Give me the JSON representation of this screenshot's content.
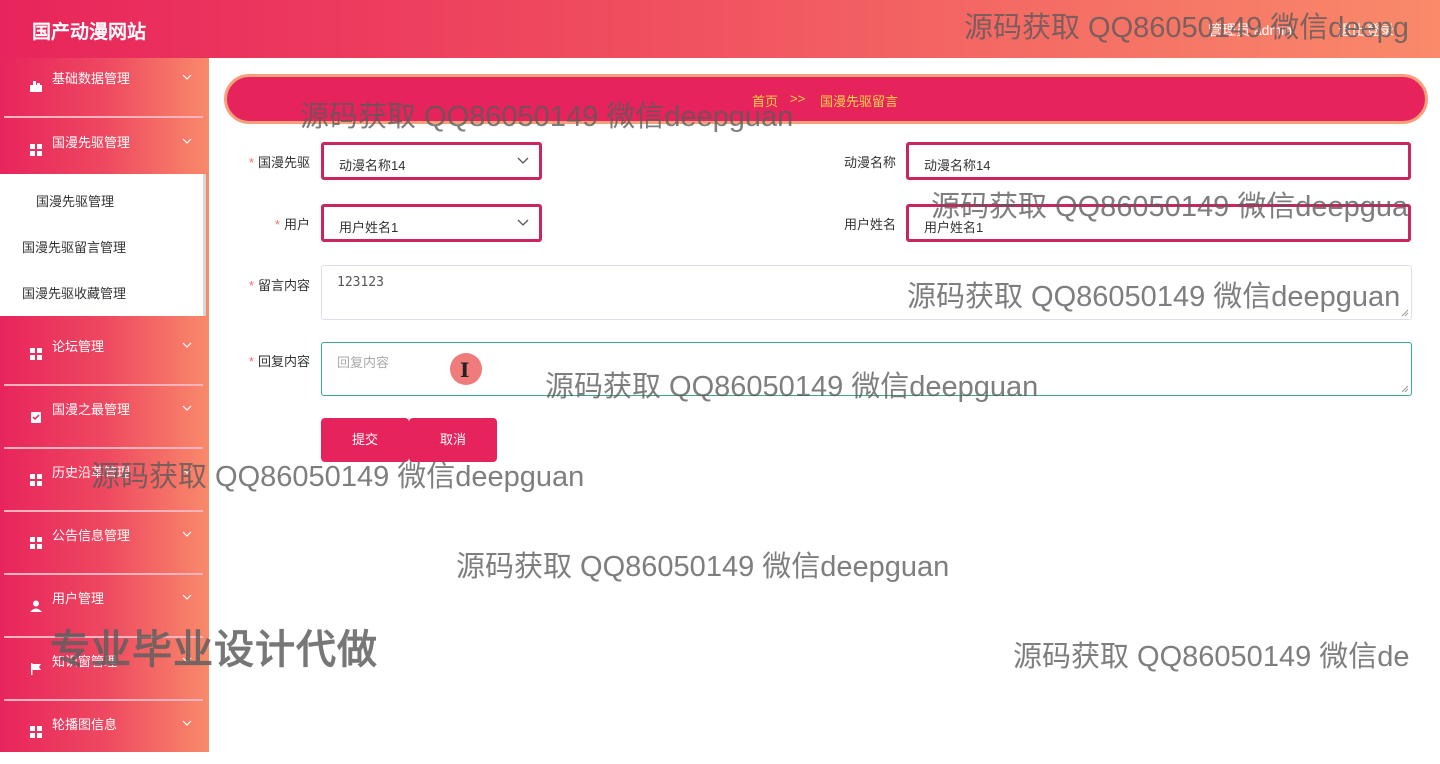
{
  "header": {
    "app_title": "国产动漫网站",
    "admin_text": "管理员 admin",
    "logout_text": "退出登录"
  },
  "sidebar": {
    "items": [
      {
        "label": "基础数据管理",
        "icon": "chart-icon"
      },
      {
        "label": "国漫先驱管理",
        "icon": "grid-icon"
      },
      {
        "label": "论坛管理",
        "icon": "grid-icon"
      },
      {
        "label": "国漫之最管理",
        "icon": "clipboard-icon"
      },
      {
        "label": "历史沿革管理",
        "icon": "grid-icon"
      },
      {
        "label": "公告信息管理",
        "icon": "grid-icon"
      },
      {
        "label": "用户管理",
        "icon": "user-icon"
      },
      {
        "label": "知识窗管理",
        "icon": "flag-icon"
      },
      {
        "label": "轮播图信息",
        "icon": "grid-icon"
      }
    ],
    "submenu": [
      {
        "label": "国漫先驱管理"
      },
      {
        "label": "国漫先驱留言管理"
      },
      {
        "label": "国漫先驱收藏管理"
      }
    ]
  },
  "breadcrumb": {
    "home": "首页",
    "separator": ">>",
    "current": "国漫先驱留言"
  },
  "form": {
    "pioneer_label": "国漫先驱",
    "pioneer_value": "动漫名称14",
    "anime_name_label": "动漫名称",
    "anime_name_value": "动漫名称14",
    "user_label": "用户",
    "user_value": "用户姓名1",
    "username_label": "用户姓名",
    "username_value": "用户姓名1",
    "message_label": "留言内容",
    "message_value": "123123",
    "reply_label": "回复内容",
    "reply_placeholder": "回复内容",
    "required_mark": "*"
  },
  "buttons": {
    "submit": "提交",
    "cancel": "取消"
  },
  "cursor": {
    "glyph": "I"
  },
  "watermarks": {
    "source_text": "源码获取 QQ86050149 微信deepguan",
    "top_right": "源码获取 QQ86050149 微信deepg",
    "right_mid": "源码获取 QQ86050149 微信deepgua",
    "bottom_right": "源码获取 QQ86050149 微信de",
    "service_ad": "专业毕业设计代做"
  },
  "colors": {
    "accent": "#e6245b",
    "gradient_end": "#f98a6a",
    "breadcrumb_text": "#ffd54a",
    "focus_border": "#3ca88f"
  }
}
